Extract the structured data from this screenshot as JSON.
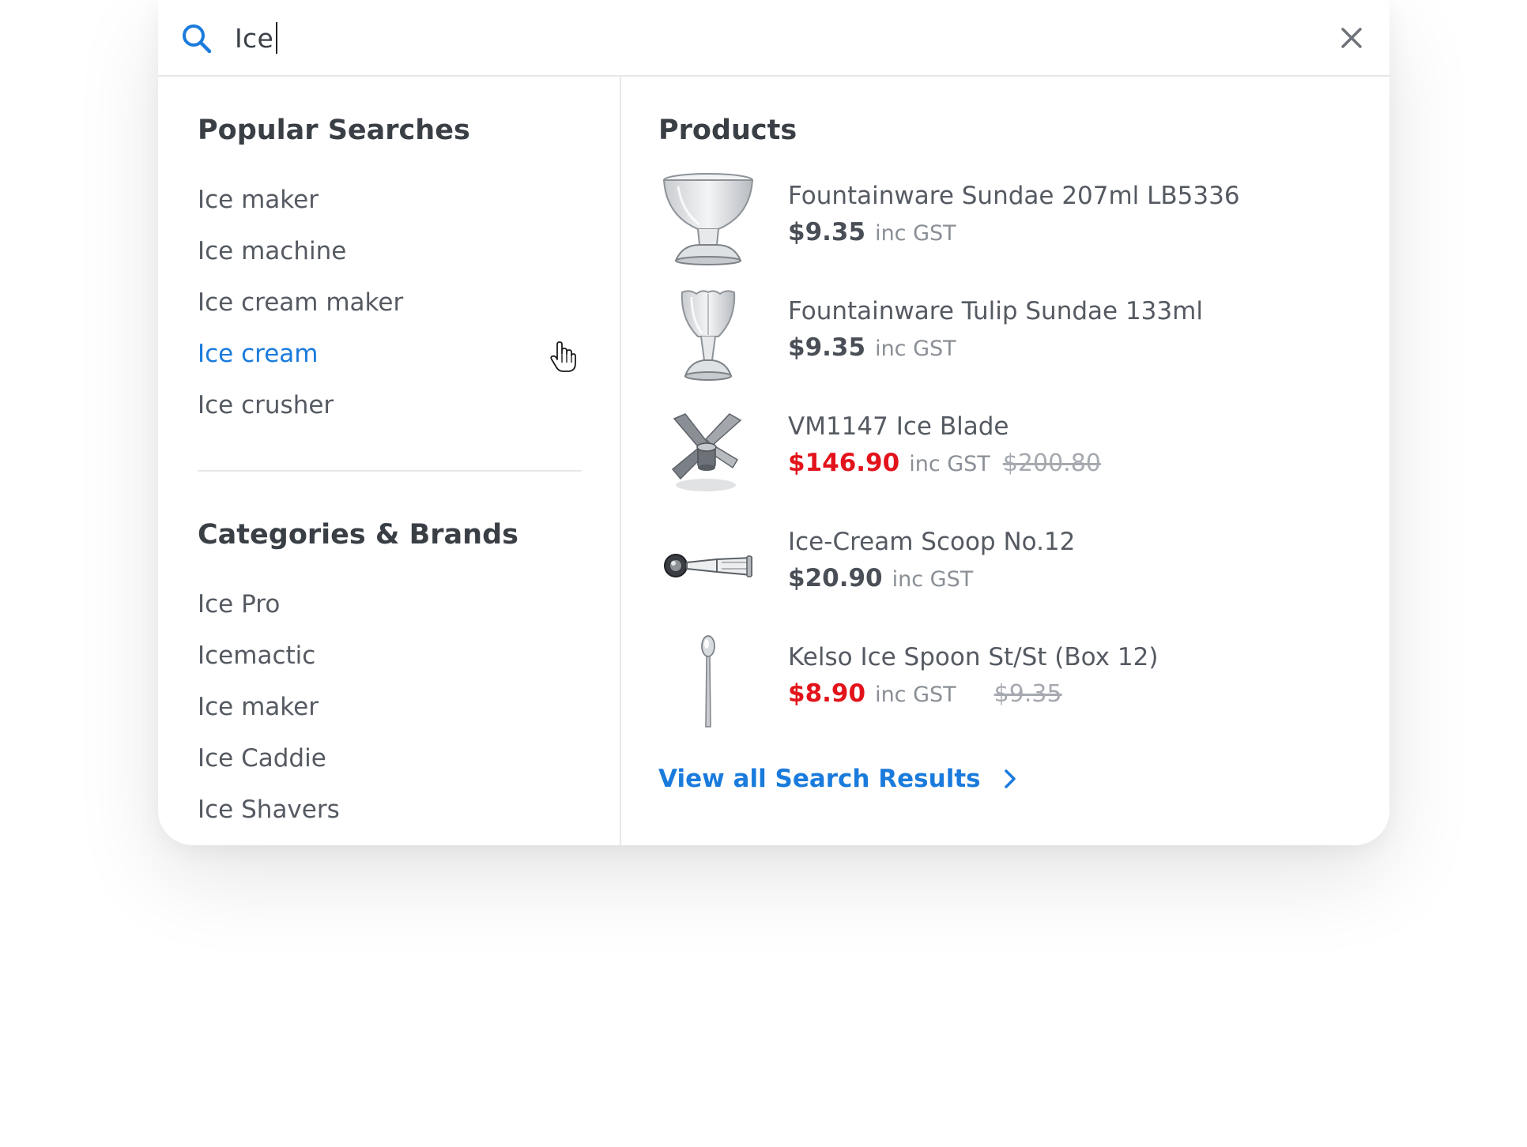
{
  "search": {
    "query": "Ice",
    "accent_color": "#1a7bdc"
  },
  "popular": {
    "title": "Popular Searches",
    "items": [
      "Ice maker",
      "Ice machine",
      "Ice cream maker",
      "Ice cream",
      "Ice crusher"
    ],
    "hovered_index": 3
  },
  "categories": {
    "title": "Categories & Brands",
    "items": [
      "Ice Pro",
      "Icemactic",
      "Ice maker",
      "Ice Caddie",
      "Ice Shavers"
    ]
  },
  "products": {
    "title": "Products",
    "items": [
      {
        "name": "Fountainware Sundae 207ml LB5336",
        "price": "$9.35",
        "tax": "inc GST",
        "old_price": "",
        "on_sale": false,
        "icon": "sundae-glass-icon"
      },
      {
        "name": "Fountainware Tulip Sundae 133ml",
        "price": "$9.35",
        "tax": "inc GST",
        "old_price": "",
        "on_sale": false,
        "icon": "tulip-sundae-glass-icon"
      },
      {
        "name": "VM1147 Ice Blade",
        "price": "$146.90",
        "tax": "inc GST",
        "old_price": "$200.80",
        "on_sale": true,
        "icon": "blender-blade-icon"
      },
      {
        "name": "Ice-Cream Scoop No.12",
        "price": "$20.90",
        "tax": "inc GST",
        "old_price": "",
        "on_sale": false,
        "icon": "ice-cream-scoop-icon"
      },
      {
        "name": "Kelso Ice Spoon St/St (Box 12)",
        "price": "$8.90",
        "tax": "inc GST",
        "old_price": "$9.35",
        "on_sale": true,
        "icon": "spoon-icon"
      }
    ],
    "sale_color": "#e3131b"
  },
  "view_all": {
    "label": "View all Search Results"
  }
}
